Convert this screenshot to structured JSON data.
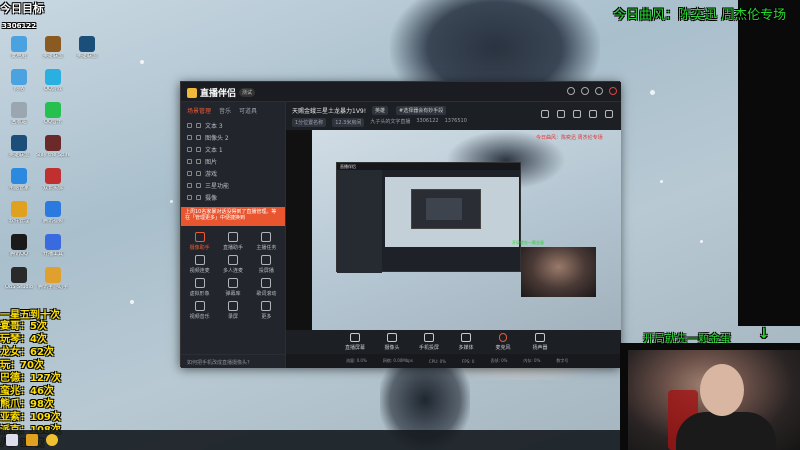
{
  "stream_overlay": {
    "room_tag": "今日目标",
    "viewer_count": "3306122",
    "song_line": "今日曲风：陈奕迅 周杰伦专场",
    "danmaku_line": "开局就先一颗金蛋",
    "leaderboard_title": "一星五到十次",
    "leaderboard": [
      "宴哥：5次",
      "玩琴：4次",
      "龙女：62次",
      "玩：70次",
      "巴德：127次",
      "蛮兆：46次",
      "熊爪：98次",
      "亚索：109次",
      "派克：108次",
      "八：19次"
    ]
  },
  "desktop": {
    "icons": [
      {
        "label": "此电脑",
        "icon": "computer-icon",
        "color": "#4aa3e0"
      },
      {
        "label": "网络",
        "icon": "network-icon",
        "color": "#4aa3e0"
      },
      {
        "label": "回收站",
        "icon": "trash-icon",
        "color": "#9aa6b0"
      },
      {
        "label": "英雄联盟",
        "icon": "game-icon",
        "color": "#1b4f7a"
      },
      {
        "label": "电脑管家",
        "icon": "shield-icon",
        "color": "#2b8ae0"
      },
      {
        "label": "软件管理",
        "icon": "apps-icon",
        "color": "#e0a020"
      },
      {
        "label": "腾讯QQ",
        "icon": "qq-icon",
        "color": "#1a1a1a"
      },
      {
        "label": "OBS Studio",
        "icon": "obs-icon",
        "color": "#2a2a2a"
      },
      {
        "label": "英雄联盟",
        "icon": "game-icon",
        "color": "#8a5a20"
      },
      {
        "label": "QQ游戏",
        "icon": "qq-game-icon",
        "color": "#2ab0e0"
      },
      {
        "label": "QQ音乐",
        "icon": "music-icon",
        "color": "#25c050"
      },
      {
        "label": "Slay the Spire",
        "icon": "spire-icon",
        "color": "#6a2a2a"
      },
      {
        "label": "双长头像",
        "icon": "image-icon",
        "color": "#c03030"
      },
      {
        "label": "腾讯视频",
        "icon": "video-icon",
        "color": "#2a7ae0"
      },
      {
        "label": "开播工具",
        "icon": "tool-icon",
        "color": "#3a6ae0"
      },
      {
        "label": "腾讯手游助手",
        "icon": "mobile-icon",
        "color": "#e0a030"
      },
      {
        "label": "英雄联盟",
        "icon": "game-icon",
        "color": "#1b4f7a"
      }
    ]
  },
  "app": {
    "name": "直播伴侣",
    "version": "测试",
    "left_tabs": [
      "场景管理",
      "音乐",
      "可道具"
    ],
    "scenes": [
      "文本 3",
      "图像头 2",
      "文本 1",
      "图片",
      "游戏",
      "三星功能",
      "摄像"
    ],
    "promo_text": "上周10名家暴对话没得到了直播管理。等在「管理更多」中便捷换到",
    "tools": [
      {
        "label": "摄像助手",
        "active": true
      },
      {
        "label": "直播助手",
        "active": false
      },
      {
        "label": "主播任务",
        "active": false
      },
      {
        "label": "视频连麦",
        "active": false
      },
      {
        "label": "多人连麦",
        "active": false
      },
      {
        "label": "投屏播",
        "active": false
      },
      {
        "label": "虚拟形象",
        "active": false
      },
      {
        "label": "弹幕库",
        "active": false
      },
      {
        "label": "歌词滚动",
        "active": false
      },
      {
        "label": "视频音乐",
        "active": false
      },
      {
        "label": "录屏",
        "active": false
      },
      {
        "label": "更多",
        "active": false
      }
    ],
    "footer_hint": "如何把手机改成直播摄像头?",
    "stream_title": "天赐金蛾三星土龙暴力1V9!",
    "stream_tags": [
      "英雄",
      "#选择器会有妙手段"
    ],
    "sub_info": [
      "1分位置名称",
      "12.3米房间",
      "九子头的文字直播",
      "3306122",
      "1376510"
    ],
    "preview_song": "今日曲风：陈奕迅 周杰伦专场",
    "preview_scroll": "开局就先一颗金蛋",
    "controls": [
      "直播屏幕",
      "摄像头",
      "手机投屏",
      "多媒体",
      "麦克风",
      "扬声器"
    ],
    "status": [
      "流量: 0.0%",
      "网络: 0.00Mbps",
      "CPU: 0%",
      "FPS: 0",
      "丢帧: 0%",
      "内存: 0%",
      "数字号"
    ]
  },
  "colors": {
    "overlay_green": "#25d92c",
    "leaderboard_yellow": "#ffe000",
    "accent_orange": "#f05a33",
    "app_bg": "#1e2127"
  }
}
